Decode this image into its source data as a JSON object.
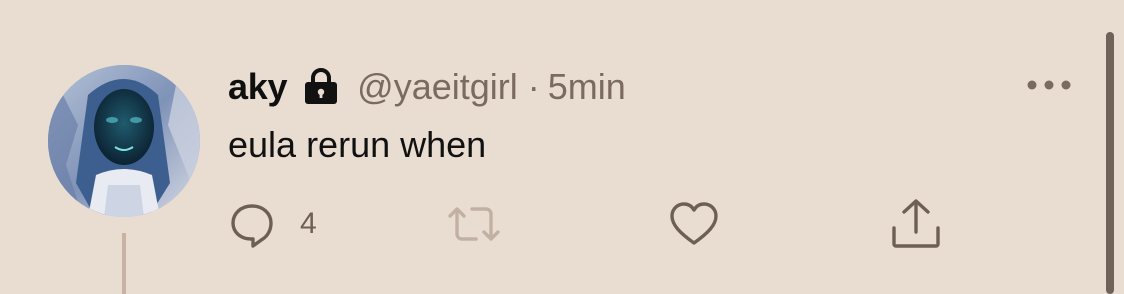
{
  "tweet": {
    "display_name": "aky",
    "handle": "@yaeitgirl",
    "separator": "·",
    "time": "5min",
    "text": "eula rerun when",
    "reply_count": "4"
  },
  "icons": {
    "lock": "lock-icon",
    "more": "more-icon",
    "reply": "reply-icon",
    "retweet": "retweet-icon",
    "like": "heart-icon",
    "share": "share-icon"
  },
  "colors": {
    "background": "#e9ddd2",
    "secondary_text": "#7a6a5f",
    "icon": "#6e5f55",
    "retweet_disabled": "#c2b1a3"
  }
}
